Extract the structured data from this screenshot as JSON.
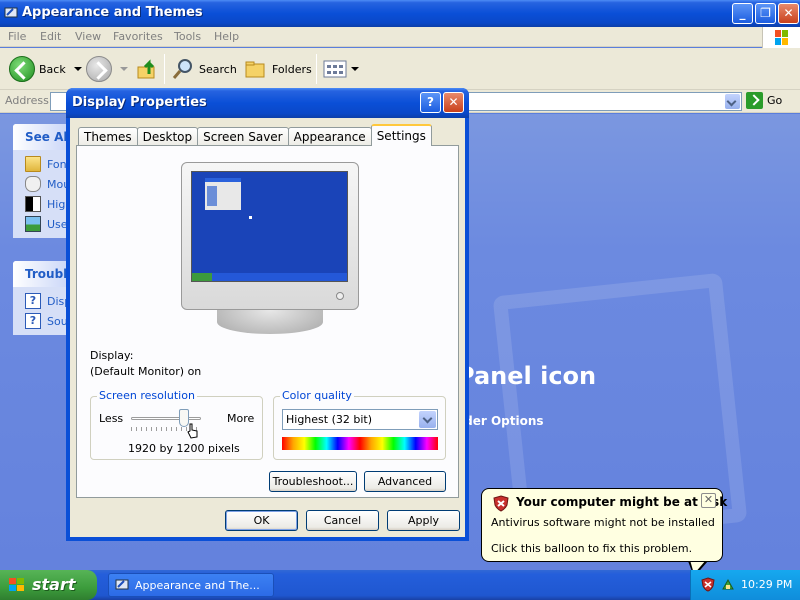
{
  "explorer": {
    "title": "Appearance and Themes",
    "menu": [
      "File",
      "Edit",
      "View",
      "Favorites",
      "Tools",
      "Help"
    ],
    "toolbar": {
      "back": "Back",
      "search": "Search",
      "folders": "Folders"
    },
    "address": {
      "label": "Address",
      "go": "Go"
    },
    "side_panels": [
      {
        "title": "See Als",
        "items": [
          "Fon",
          "Mou",
          "High",
          "Use"
        ]
      },
      {
        "title": "Trouble",
        "items": [
          "Disp",
          "Sou"
        ]
      }
    ],
    "content": {
      "heading": "Panel icon",
      "link": "lder Options"
    }
  },
  "dialog": {
    "title": "Display Properties",
    "tabs": [
      "Themes",
      "Desktop",
      "Screen Saver",
      "Appearance",
      "Settings"
    ],
    "active_tab": "Settings",
    "display_label": "Display:",
    "display_value": "(Default Monitor) on",
    "resolution": {
      "title": "Screen resolution",
      "less": "Less",
      "more": "More",
      "value_text": "1920 by 1200 pixels",
      "slider_position": 0.75
    },
    "color_quality": {
      "title": "Color quality",
      "selected": "Highest (32 bit)"
    },
    "buttons": {
      "troubleshoot": "Troubleshoot...",
      "advanced": "Advanced",
      "ok": "OK",
      "cancel": "Cancel",
      "apply": "Apply"
    }
  },
  "balloon": {
    "title": "Your computer might be at risk",
    "line1": "Antivirus software might not be installed",
    "line2": "Click this balloon to fix this problem."
  },
  "taskbar": {
    "start": "start",
    "task_title": "Appearance and The...",
    "clock": "10:29 PM"
  }
}
